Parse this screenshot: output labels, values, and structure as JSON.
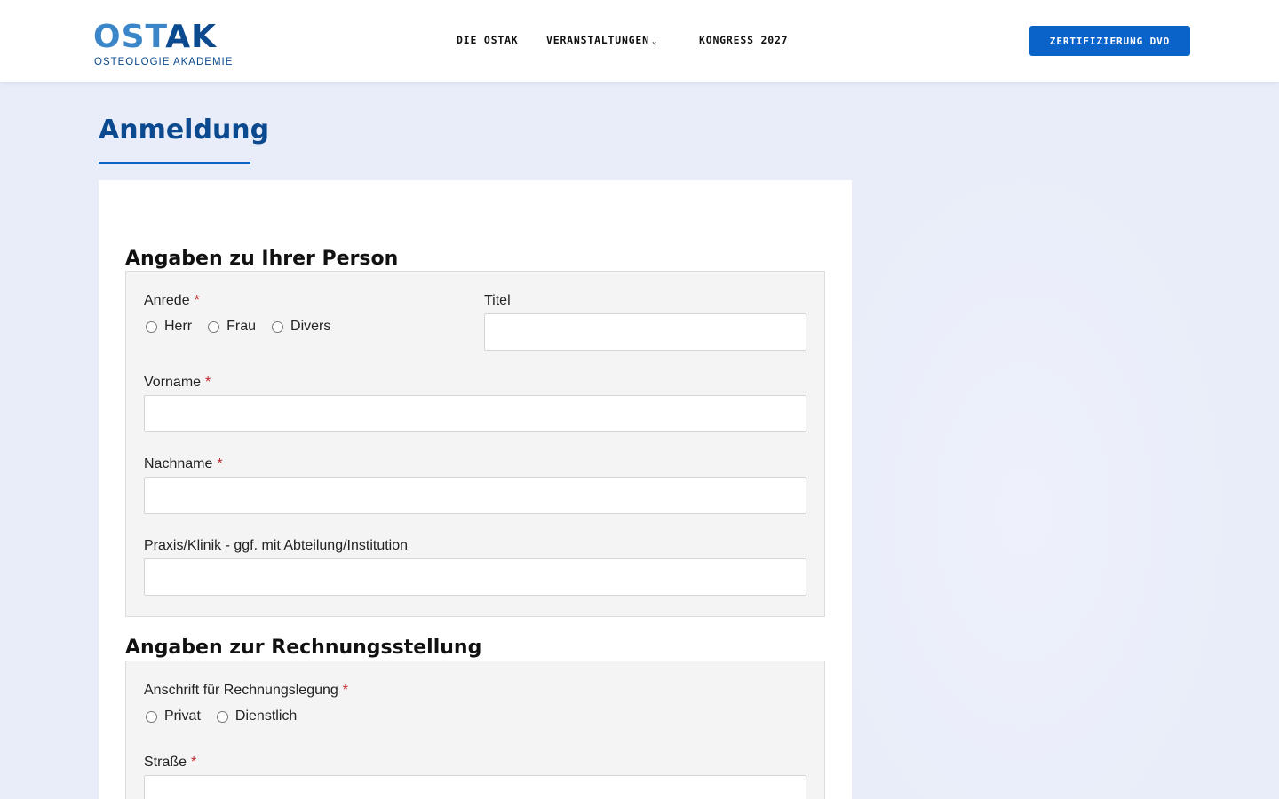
{
  "header": {
    "logo_word_main": "OST",
    "logo_word_accent": "AK",
    "logo_sub": "OSTEOLOGIE AKADEMIE",
    "nav": [
      {
        "label": "DIE OSTAK"
      },
      {
        "label": "VERANSTALTUNGEN",
        "chevron": "⌄"
      },
      {
        "label": "KONGRESS 2027"
      }
    ],
    "cta_label": "ZERTIFIZIERUNG DVO"
  },
  "page": {
    "title": "Anmeldung"
  },
  "person_section": {
    "title": "Angaben zu Ihrer Person",
    "anrede_label": "Anrede",
    "anrede_options": [
      "Herr",
      "Frau",
      "Divers"
    ],
    "titel_label": "Titel",
    "titel_value": "",
    "vorname_label": "Vorname",
    "vorname_value": "",
    "nachname_label": "Nachname",
    "nachname_value": "",
    "praxis_label": "Praxis/Klinik - ggf. mit Abteilung/Institution",
    "praxis_value": ""
  },
  "billing_section": {
    "title": "Angaben zur Rechnungsstellung",
    "anschrift_label": "Anschrift für Rechnungslegung",
    "anschrift_options": [
      "Privat",
      "Dienstlich"
    ],
    "strasse_label": "Straße",
    "strasse_value": ""
  },
  "required_mark": "*",
  "colors": {
    "brand_dark": "#0b4a8f",
    "brand_light": "#3a86c8",
    "accent": "#0a63c9",
    "required": "#c0262d",
    "page_bg": "#e9edf9"
  }
}
